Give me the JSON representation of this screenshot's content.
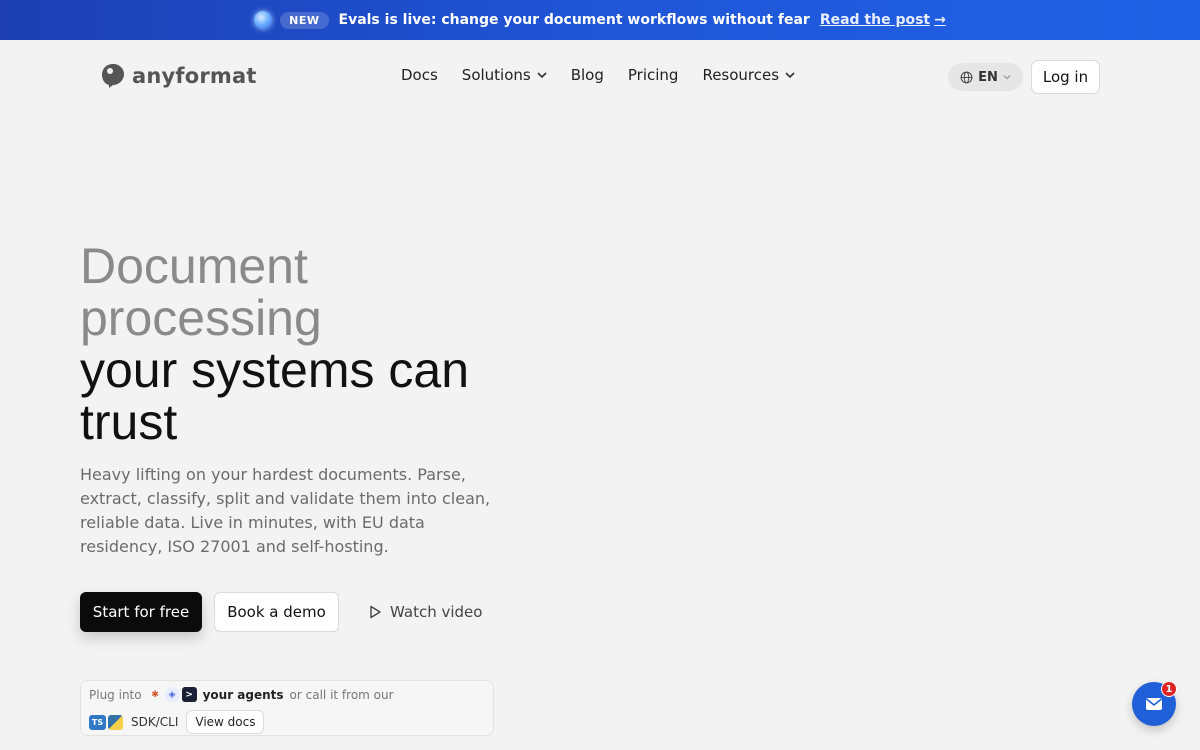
{
  "announcement": {
    "badge": "NEW",
    "message": "Evals is live: change your document workflows without fear",
    "link": "Read the post",
    "arrow": "→"
  },
  "brand": {
    "name": "anyformat"
  },
  "nav": {
    "items": [
      {
        "label": "Docs",
        "has_dropdown": false
      },
      {
        "label": "Solutions",
        "has_dropdown": true
      },
      {
        "label": "Blog",
        "has_dropdown": false
      },
      {
        "label": "Pricing",
        "has_dropdown": false
      },
      {
        "label": "Resources",
        "has_dropdown": true
      }
    ]
  },
  "language": {
    "value": "EN"
  },
  "login": {
    "label": "Log in"
  },
  "hero": {
    "headline_grey_1": "Document",
    "headline_grey_2": "processing",
    "headline_dark_1": "your systems can",
    "headline_dark_2": "trust",
    "subtitle": "Heavy lifting on your hardest documents. Parse, extract, classify, split and validate them into clean, reliable data. Live in minutes, with EU data residency, ISO 27001 and self-hosting."
  },
  "cta": {
    "primary": "Start for free",
    "secondary": "Book a demo",
    "video": "Watch video"
  },
  "plug": {
    "prefix": "Plug into",
    "agents": "your agents",
    "suffix": "or call it from our",
    "sdk": "SDK/CLI",
    "docs_button": "View docs"
  },
  "chat": {
    "unread": "1"
  },
  "colors": {
    "banner": "#1f55d6",
    "primary_button": "#0b0b0b",
    "chat": "#1f5fd8",
    "badge": "#e02424"
  }
}
